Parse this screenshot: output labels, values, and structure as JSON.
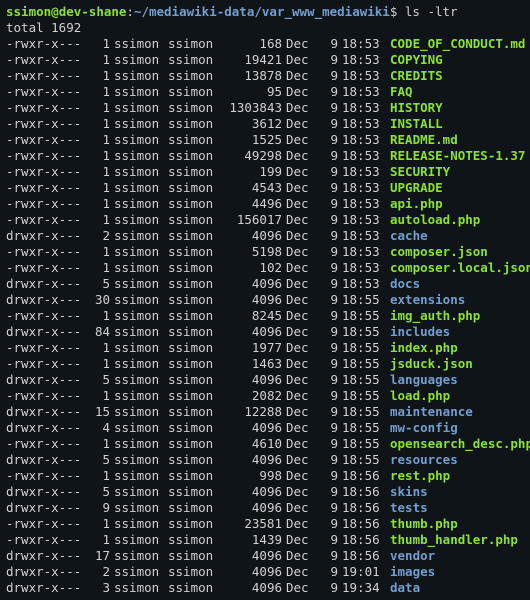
{
  "prompt": {
    "user": "ssimon",
    "at": "@",
    "host": "dev-shane",
    "colon": ":",
    "path": "~/mediawiki-data/var_www_mediawiki",
    "dollar": "$",
    "command": "ls -ltr"
  },
  "total_label": "total 1692",
  "entries": [
    {
      "perm": "-rwxr-x---",
      "links": "1",
      "owner": "ssimon",
      "group": "ssimon",
      "size": "168",
      "mon": "Dec",
      "day": "9",
      "time": "18:53",
      "name": "CODE_OF_CONDUCT.md",
      "type": "file"
    },
    {
      "perm": "-rwxr-x---",
      "links": "1",
      "owner": "ssimon",
      "group": "ssimon",
      "size": "19421",
      "mon": "Dec",
      "day": "9",
      "time": "18:53",
      "name": "COPYING",
      "type": "file"
    },
    {
      "perm": "-rwxr-x---",
      "links": "1",
      "owner": "ssimon",
      "group": "ssimon",
      "size": "13878",
      "mon": "Dec",
      "day": "9",
      "time": "18:53",
      "name": "CREDITS",
      "type": "file"
    },
    {
      "perm": "-rwxr-x---",
      "links": "1",
      "owner": "ssimon",
      "group": "ssimon",
      "size": "95",
      "mon": "Dec",
      "day": "9",
      "time": "18:53",
      "name": "FAQ",
      "type": "file"
    },
    {
      "perm": "-rwxr-x---",
      "links": "1",
      "owner": "ssimon",
      "group": "ssimon",
      "size": "1303843",
      "mon": "Dec",
      "day": "9",
      "time": "18:53",
      "name": "HISTORY",
      "type": "file"
    },
    {
      "perm": "-rwxr-x---",
      "links": "1",
      "owner": "ssimon",
      "group": "ssimon",
      "size": "3612",
      "mon": "Dec",
      "day": "9",
      "time": "18:53",
      "name": "INSTALL",
      "type": "file"
    },
    {
      "perm": "-rwxr-x---",
      "links": "1",
      "owner": "ssimon",
      "group": "ssimon",
      "size": "1525",
      "mon": "Dec",
      "day": "9",
      "time": "18:53",
      "name": "README.md",
      "type": "file"
    },
    {
      "perm": "-rwxr-x---",
      "links": "1",
      "owner": "ssimon",
      "group": "ssimon",
      "size": "49298",
      "mon": "Dec",
      "day": "9",
      "time": "18:53",
      "name": "RELEASE-NOTES-1.37",
      "type": "file"
    },
    {
      "perm": "-rwxr-x---",
      "links": "1",
      "owner": "ssimon",
      "group": "ssimon",
      "size": "199",
      "mon": "Dec",
      "day": "9",
      "time": "18:53",
      "name": "SECURITY",
      "type": "file"
    },
    {
      "perm": "-rwxr-x---",
      "links": "1",
      "owner": "ssimon",
      "group": "ssimon",
      "size": "4543",
      "mon": "Dec",
      "day": "9",
      "time": "18:53",
      "name": "UPGRADE",
      "type": "file"
    },
    {
      "perm": "-rwxr-x---",
      "links": "1",
      "owner": "ssimon",
      "group": "ssimon",
      "size": "4496",
      "mon": "Dec",
      "day": "9",
      "time": "18:53",
      "name": "api.php",
      "type": "file"
    },
    {
      "perm": "-rwxr-x---",
      "links": "1",
      "owner": "ssimon",
      "group": "ssimon",
      "size": "156017",
      "mon": "Dec",
      "day": "9",
      "time": "18:53",
      "name": "autoload.php",
      "type": "file"
    },
    {
      "perm": "drwxr-x---",
      "links": "2",
      "owner": "ssimon",
      "group": "ssimon",
      "size": "4096",
      "mon": "Dec",
      "day": "9",
      "time": "18:53",
      "name": "cache",
      "type": "dir"
    },
    {
      "perm": "-rwxr-x---",
      "links": "1",
      "owner": "ssimon",
      "group": "ssimon",
      "size": "5198",
      "mon": "Dec",
      "day": "9",
      "time": "18:53",
      "name": "composer.json",
      "type": "file"
    },
    {
      "perm": "-rwxr-x---",
      "links": "1",
      "owner": "ssimon",
      "group": "ssimon",
      "size": "102",
      "mon": "Dec",
      "day": "9",
      "time": "18:53",
      "name": "composer.local.json-sample",
      "type": "file"
    },
    {
      "perm": "drwxr-x---",
      "links": "5",
      "owner": "ssimon",
      "group": "ssimon",
      "size": "4096",
      "mon": "Dec",
      "day": "9",
      "time": "18:53",
      "name": "docs",
      "type": "dir"
    },
    {
      "perm": "drwxr-x---",
      "links": "30",
      "owner": "ssimon",
      "group": "ssimon",
      "size": "4096",
      "mon": "Dec",
      "day": "9",
      "time": "18:55",
      "name": "extensions",
      "type": "dir"
    },
    {
      "perm": "-rwxr-x---",
      "links": "1",
      "owner": "ssimon",
      "group": "ssimon",
      "size": "8245",
      "mon": "Dec",
      "day": "9",
      "time": "18:55",
      "name": "img_auth.php",
      "type": "file"
    },
    {
      "perm": "drwxr-x---",
      "links": "84",
      "owner": "ssimon",
      "group": "ssimon",
      "size": "4096",
      "mon": "Dec",
      "day": "9",
      "time": "18:55",
      "name": "includes",
      "type": "dir"
    },
    {
      "perm": "-rwxr-x---",
      "links": "1",
      "owner": "ssimon",
      "group": "ssimon",
      "size": "1977",
      "mon": "Dec",
      "day": "9",
      "time": "18:55",
      "name": "index.php",
      "type": "file"
    },
    {
      "perm": "-rwxr-x---",
      "links": "1",
      "owner": "ssimon",
      "group": "ssimon",
      "size": "1463",
      "mon": "Dec",
      "day": "9",
      "time": "18:55",
      "name": "jsduck.json",
      "type": "file"
    },
    {
      "perm": "drwxr-x---",
      "links": "5",
      "owner": "ssimon",
      "group": "ssimon",
      "size": "4096",
      "mon": "Dec",
      "day": "9",
      "time": "18:55",
      "name": "languages",
      "type": "dir"
    },
    {
      "perm": "-rwxr-x---",
      "links": "1",
      "owner": "ssimon",
      "group": "ssimon",
      "size": "2082",
      "mon": "Dec",
      "day": "9",
      "time": "18:55",
      "name": "load.php",
      "type": "file"
    },
    {
      "perm": "drwxr-x---",
      "links": "15",
      "owner": "ssimon",
      "group": "ssimon",
      "size": "12288",
      "mon": "Dec",
      "day": "9",
      "time": "18:55",
      "name": "maintenance",
      "type": "dir"
    },
    {
      "perm": "drwxr-x---",
      "links": "4",
      "owner": "ssimon",
      "group": "ssimon",
      "size": "4096",
      "mon": "Dec",
      "day": "9",
      "time": "18:55",
      "name": "mw-config",
      "type": "dir"
    },
    {
      "perm": "-rwxr-x---",
      "links": "1",
      "owner": "ssimon",
      "group": "ssimon",
      "size": "4610",
      "mon": "Dec",
      "day": "9",
      "time": "18:55",
      "name": "opensearch_desc.php",
      "type": "file"
    },
    {
      "perm": "drwxr-x---",
      "links": "5",
      "owner": "ssimon",
      "group": "ssimon",
      "size": "4096",
      "mon": "Dec",
      "day": "9",
      "time": "18:55",
      "name": "resources",
      "type": "dir"
    },
    {
      "perm": "-rwxr-x---",
      "links": "1",
      "owner": "ssimon",
      "group": "ssimon",
      "size": "998",
      "mon": "Dec",
      "day": "9",
      "time": "18:56",
      "name": "rest.php",
      "type": "file"
    },
    {
      "perm": "drwxr-x---",
      "links": "5",
      "owner": "ssimon",
      "group": "ssimon",
      "size": "4096",
      "mon": "Dec",
      "day": "9",
      "time": "18:56",
      "name": "skins",
      "type": "dir"
    },
    {
      "perm": "drwxr-x---",
      "links": "9",
      "owner": "ssimon",
      "group": "ssimon",
      "size": "4096",
      "mon": "Dec",
      "day": "9",
      "time": "18:56",
      "name": "tests",
      "type": "dir"
    },
    {
      "perm": "-rwxr-x---",
      "links": "1",
      "owner": "ssimon",
      "group": "ssimon",
      "size": "23581",
      "mon": "Dec",
      "day": "9",
      "time": "18:56",
      "name": "thumb.php",
      "type": "file"
    },
    {
      "perm": "-rwxr-x---",
      "links": "1",
      "owner": "ssimon",
      "group": "ssimon",
      "size": "1439",
      "mon": "Dec",
      "day": "9",
      "time": "18:56",
      "name": "thumb_handler.php",
      "type": "file"
    },
    {
      "perm": "drwxr-x---",
      "links": "17",
      "owner": "ssimon",
      "group": "ssimon",
      "size": "4096",
      "mon": "Dec",
      "day": "9",
      "time": "18:56",
      "name": "vendor",
      "type": "dir"
    },
    {
      "perm": "drwxr-x---",
      "links": "2",
      "owner": "ssimon",
      "group": "ssimon",
      "size": "4096",
      "mon": "Dec",
      "day": "9",
      "time": "19:01",
      "name": "images",
      "type": "dir"
    },
    {
      "perm": "drwxr-x---",
      "links": "3",
      "owner": "ssimon",
      "group": "ssimon",
      "size": "4096",
      "mon": "Dec",
      "day": "9",
      "time": "19:34",
      "name": "data",
      "type": "dir"
    }
  ]
}
